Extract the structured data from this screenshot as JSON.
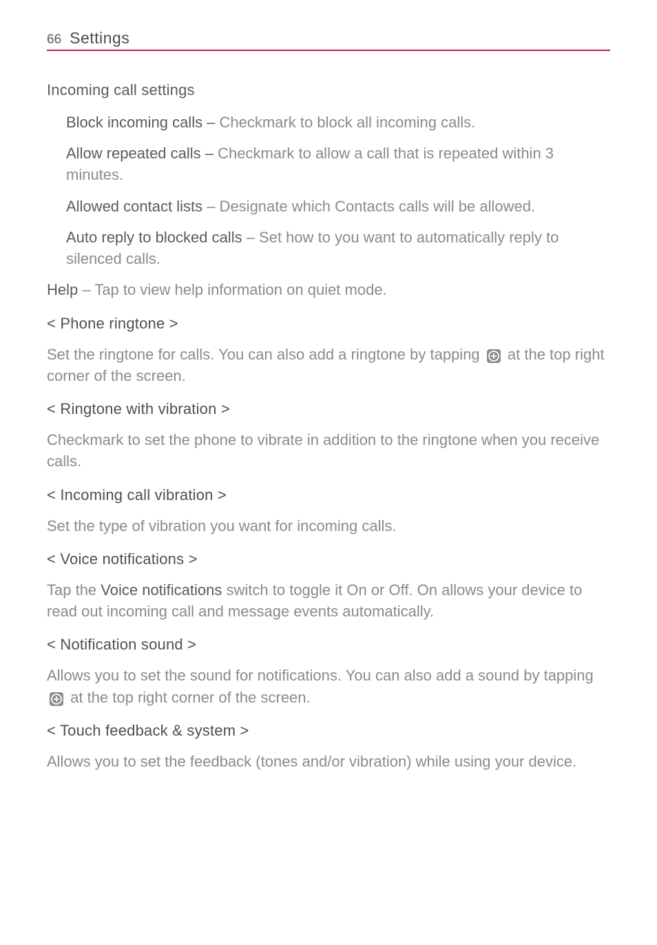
{
  "header": {
    "page_number": "66",
    "title": "Settings"
  },
  "content": {
    "incoming_heading": "Incoming call settings",
    "block_incoming": {
      "lead": "Block incoming calls – ",
      "desc": "Checkmark to block all incoming calls."
    },
    "allow_repeated": {
      "lead": "Allow repeated calls – ",
      "desc": "Checkmark to allow a call that is repeated within 3 minutes."
    },
    "allowed_contacts": {
      "lead": "Allowed contact lists",
      "desc": " – Designate which Contacts calls will be allowed."
    },
    "auto_reply": {
      "lead": "Auto reply to blocked calls",
      "desc": " – Set how to you want to automatically reply to silenced calls."
    },
    "help": {
      "lead": "Help",
      "desc": " – Tap to view help information on quiet mode."
    },
    "phone_ringtone": {
      "heading": "< Phone ringtone >",
      "desc_pre": "Set the ringtone for calls. You can also add a ringtone by tapping ",
      "desc_post": " at the top right corner of the screen."
    },
    "ringtone_vibration": {
      "heading": "< Ringtone with vibration >",
      "desc": "Checkmark to set the phone to vibrate in addition to the ringtone when you receive calls."
    },
    "incoming_vibration": {
      "heading": "< Incoming call vibration >",
      "desc": "Set the type of vibration you want for incoming calls."
    },
    "voice_notifications": {
      "heading": "< Voice notifications >",
      "desc_pre": "Tap the ",
      "lead": "Voice notifications",
      "desc_post": " switch to toggle it On or Off. On allows your device to read out incoming call and message events automatically."
    },
    "notification_sound": {
      "heading": "< Notification sound >",
      "desc_pre": "Allows you to set the sound for notifications. You can also add a sound by tapping ",
      "desc_post": " at the top right corner of the screen."
    },
    "touch_feedback": {
      "heading": "< Touch feedback & system >",
      "desc": "Allows you to set the feedback (tones and/or vibration) while using your device."
    }
  }
}
